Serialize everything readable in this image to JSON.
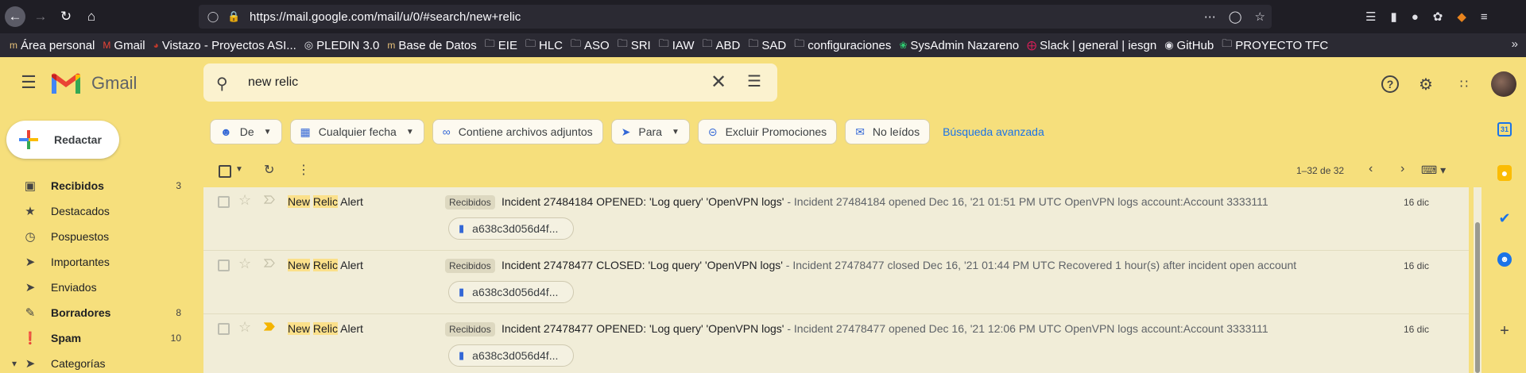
{
  "browser": {
    "url": "https://mail.google.com/mail/u/0/#search/new+relic",
    "bookmarks": [
      {
        "label": "Área personal",
        "icon": "moodle-icon"
      },
      {
        "label": "Gmail",
        "icon": "gmail-icon"
      },
      {
        "label": "Vistazo - Proyectos ASI...",
        "icon": "redmine-icon"
      },
      {
        "label": "PLEDIN 3.0",
        "icon": "globe-icon"
      },
      {
        "label": "Base de Datos",
        "icon": "moodle-icon"
      },
      {
        "label": "EIE",
        "icon": "folder-icon"
      },
      {
        "label": "HLC",
        "icon": "folder-icon"
      },
      {
        "label": "ASO",
        "icon": "folder-icon"
      },
      {
        "label": "SRI",
        "icon": "folder-icon"
      },
      {
        "label": "IAW",
        "icon": "folder-icon"
      },
      {
        "label": "ABD",
        "icon": "folder-icon"
      },
      {
        "label": "SAD",
        "icon": "folder-icon"
      },
      {
        "label": "configuraciones",
        "icon": "folder-icon"
      },
      {
        "label": "SysAdmin Nazareno",
        "icon": "leaf-icon"
      },
      {
        "label": "Slack | general | iesgn",
        "icon": "slack-icon"
      },
      {
        "label": "GitHub",
        "icon": "github-icon"
      },
      {
        "label": "PROYECTO TFC",
        "icon": "folder-icon"
      }
    ]
  },
  "gmail": {
    "product_name": "Gmail",
    "search_value": "new relic",
    "compose_label": "Redactar",
    "sidebar": [
      {
        "label": "Recibidos",
        "count": "3",
        "bold": true,
        "icon": "inbox-icon"
      },
      {
        "label": "Destacados",
        "count": "",
        "bold": false,
        "icon": "star-icon"
      },
      {
        "label": "Pospuestos",
        "count": "",
        "bold": false,
        "icon": "clock-icon"
      },
      {
        "label": "Importantes",
        "count": "",
        "bold": false,
        "icon": "important-icon"
      },
      {
        "label": "Enviados",
        "count": "",
        "bold": false,
        "icon": "send-icon"
      },
      {
        "label": "Borradores",
        "count": "8",
        "bold": true,
        "icon": "draft-icon"
      },
      {
        "label": "Spam",
        "count": "10",
        "bold": true,
        "icon": "spam-icon"
      },
      {
        "label": "Categorías",
        "count": "",
        "bold": false,
        "icon": "label-icon"
      }
    ],
    "chips": [
      {
        "label": "De",
        "icon": "person-icon",
        "dropdown": true
      },
      {
        "label": "Cualquier fecha",
        "icon": "calendar-icon",
        "dropdown": true
      },
      {
        "label": "Contiene archivos adjuntos",
        "icon": "attachment-icon",
        "dropdown": false
      },
      {
        "label": "Para",
        "icon": "send-icon",
        "dropdown": true
      },
      {
        "label": "Excluir Promociones",
        "icon": "minus-circle-icon",
        "dropdown": false
      },
      {
        "label": "No leídos",
        "icon": "mail-icon",
        "dropdown": false
      }
    ],
    "advanced_search": "Búsqueda avanzada",
    "page_info": "1–32 de 32",
    "emails": [
      {
        "sender_hl1": "New",
        "sender_hl2": "Relic",
        "sender_rest": "Alert",
        "label": "Recibidos",
        "subject": "Incident 27484184 OPENED: 'Log query' 'OpenVPN logs'",
        "snippet": " - Incident 27484184 opened Dec 16, '21 01:51 PM UTC OpenVPN logs account:Account 3333111",
        "date": "16 dic",
        "attachment": "a638c3d056d4f...",
        "important": false
      },
      {
        "sender_hl1": "New",
        "sender_hl2": "Relic",
        "sender_rest": "Alert",
        "label": "Recibidos",
        "subject": "Incident 27478477 CLOSED: 'Log query' 'OpenVPN logs'",
        "snippet": " - Incident 27478477 closed Dec 16, '21 01:44 PM UTC Recovered 1 hour(s) after incident open account",
        "date": "16 dic",
        "attachment": "a638c3d056d4f...",
        "important": false
      },
      {
        "sender_hl1": "New",
        "sender_hl2": "Relic",
        "sender_rest": "Alert",
        "label": "Recibidos",
        "subject": "Incident 27478477 OPENED: 'Log query' 'OpenVPN logs'",
        "snippet": " - Incident 27478477 opened Dec 16, '21 12:06 PM UTC OpenVPN logs account:Account 3333111",
        "date": "16 dic",
        "attachment": "a638c3d056d4f...",
        "important": true
      }
    ]
  },
  "colors": {
    "theme_yellow": "#f6df7c",
    "highlight": "#fbe08a",
    "link_blue": "#1a73e8",
    "important_marker": "#f4b400"
  }
}
